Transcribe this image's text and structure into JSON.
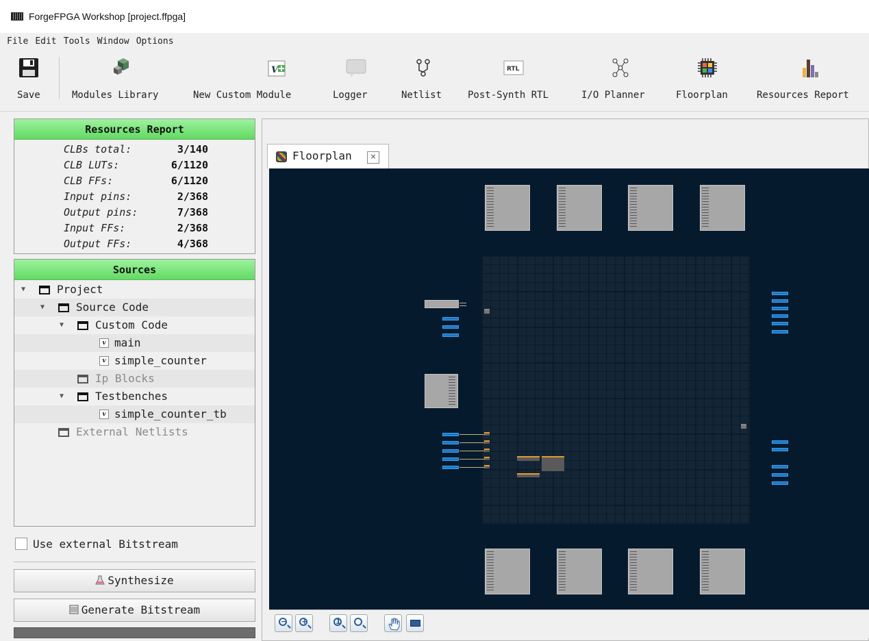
{
  "window": {
    "title": "ForgeFPGA Workshop [project.ffpga]"
  },
  "menu": [
    "File",
    "Edit",
    "Tools",
    "Window",
    "Options"
  ],
  "toolbar": {
    "save": "Save",
    "modules_library": "Modules Library",
    "new_custom_module": "New Custom Module",
    "logger": "Logger",
    "netlist": "Netlist",
    "post_synth_rtl": "Post-Synth RTL",
    "io_planner": "I/O Planner",
    "floorplan": "Floorplan",
    "resources_report": "Resources Report",
    "rtl_badge": "RTL"
  },
  "resources": {
    "title": "Resources Report",
    "rows": [
      {
        "label": "CLBs total:",
        "value": "3/140"
      },
      {
        "label": "CLB LUTs:",
        "value": "6/1120"
      },
      {
        "label": "CLB FFs:",
        "value": "6/1120"
      },
      {
        "label": "Input pins:",
        "value": "2/368"
      },
      {
        "label": "Output pins:",
        "value": "7/368"
      },
      {
        "label": "Input FFs:",
        "value": "2/368"
      },
      {
        "label": "Output FFs:",
        "value": "4/368"
      }
    ]
  },
  "sources": {
    "title": "Sources",
    "project": "Project",
    "source_code": "Source Code",
    "custom_code": "Custom Code",
    "main": "main",
    "simple_counter": "simple_counter",
    "ip_blocks": "Ip Blocks",
    "testbenches": "Testbenches",
    "simple_counter_tb": "simple_counter_tb",
    "external_netlists": "External Netlists",
    "file_badge": "v"
  },
  "options": {
    "use_external_bitstream": "Use external Bitstream",
    "use_external_bitstream_checked": false
  },
  "actions": {
    "synthesize": "Synthesize",
    "generate_bitstream": "Generate Bitstream"
  },
  "editor": {
    "tab_label": "Floorplan",
    "close_glyph": "×"
  },
  "colors": {
    "canvas_bg": "#061a2e",
    "header_green": "#62d962",
    "io_blue": "#1f77c2",
    "net_gold": "#c9b27a"
  }
}
